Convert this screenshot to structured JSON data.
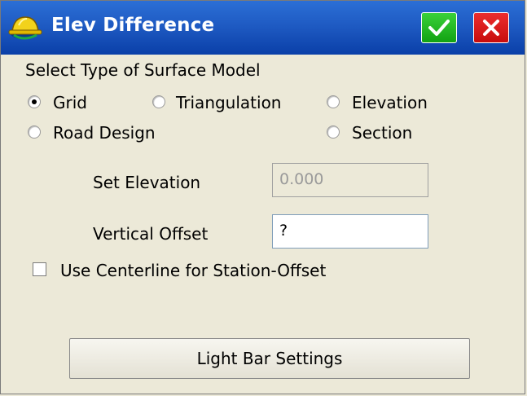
{
  "window": {
    "title": "Elev Difference"
  },
  "surface": {
    "heading": "Select Type of Surface Model",
    "options": [
      {
        "label": "Grid",
        "selected": true
      },
      {
        "label": "Triangulation",
        "selected": false
      },
      {
        "label": "Elevation",
        "selected": false
      },
      {
        "label": "Road Design",
        "selected": false
      },
      {
        "label": "Section",
        "selected": false
      }
    ]
  },
  "fields": {
    "set_elevation_label": "Set Elevation",
    "set_elevation_value": "0.000",
    "vertical_offset_label": "Vertical Offset",
    "vertical_offset_value": "?"
  },
  "centerline": {
    "label": "Use Centerline for Station-Offset",
    "checked": false
  },
  "buttons": {
    "light_bar": "Light Bar Settings"
  },
  "icons": {
    "app": "hardhat-icon",
    "ok": "checkmark-icon",
    "close": "close-icon"
  },
  "colors": {
    "titlebar": "#1f5bc3",
    "ok": "#1fae1f",
    "close": "#d81a1a",
    "dialog": "#ece9d8"
  }
}
